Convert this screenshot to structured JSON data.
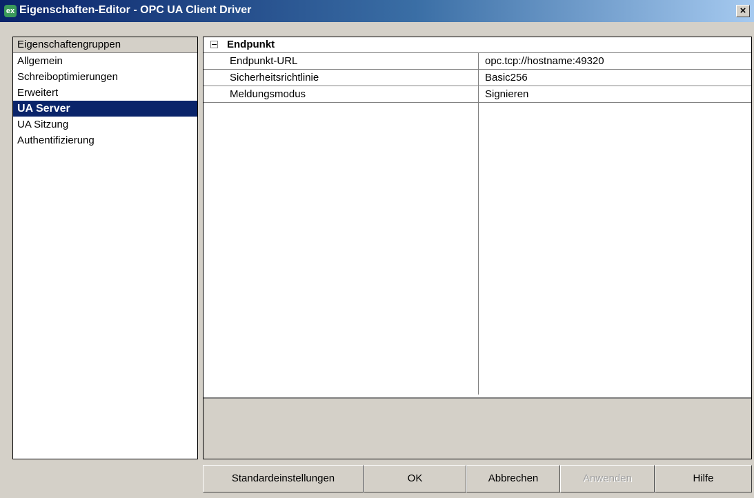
{
  "window": {
    "title": "Eigenschaften-Editor - OPC UA Client Driver",
    "app_icon_text": "ex",
    "close_symbol": "×"
  },
  "groups": {
    "header": "Eigenschaftengruppen",
    "items": [
      {
        "label": "Allgemein",
        "selected": false
      },
      {
        "label": "Schreiboptimierungen",
        "selected": false
      },
      {
        "label": "Erweitert",
        "selected": false
      },
      {
        "label": "UA Server",
        "selected": true
      },
      {
        "label": "UA Sitzung",
        "selected": false
      },
      {
        "label": "Authentifizierung",
        "selected": false
      }
    ]
  },
  "properties": {
    "section_title": "Endpunkt",
    "rows": [
      {
        "name": "Endpunkt-URL",
        "value": "opc.tcp://hostname:49320"
      },
      {
        "name": "Sicherheitsrichtlinie",
        "value": "Basic256"
      },
      {
        "name": "Meldungsmodus",
        "value": "Signieren"
      }
    ]
  },
  "buttons": {
    "defaults": "Standardeinstellungen",
    "ok": "OK",
    "cancel": "Abbrechen",
    "apply": "Anwenden",
    "help": "Hilfe"
  },
  "colors": {
    "selection": "#0a246a",
    "dialog_bg": "#d4d0c8"
  }
}
